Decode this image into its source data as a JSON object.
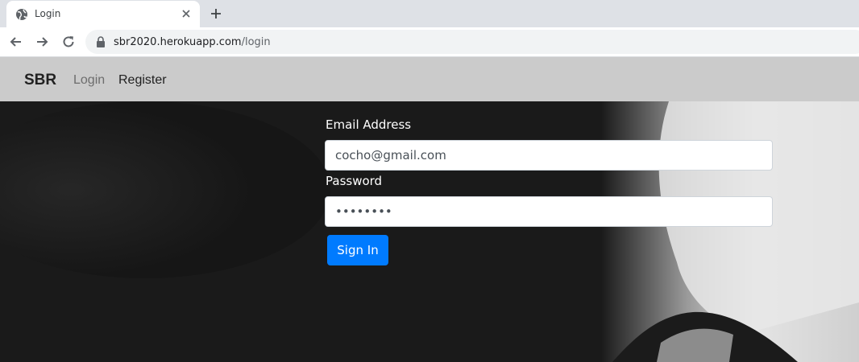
{
  "browser": {
    "tab_title": "Login",
    "url_host": "sbr2020.herokuapp.com",
    "url_path": "/login"
  },
  "navbar": {
    "brand": "SBR",
    "links": [
      "Login",
      "Register"
    ]
  },
  "form": {
    "email_label": "Email Address",
    "email_value": "cocho@gmail.com",
    "password_label": "Password",
    "password_value": "••••••••",
    "submit_label": "Sign In"
  },
  "colors": {
    "primary": "#007bff",
    "navbar_bg": "#cbcbcb",
    "hero_bg": "#141414"
  }
}
